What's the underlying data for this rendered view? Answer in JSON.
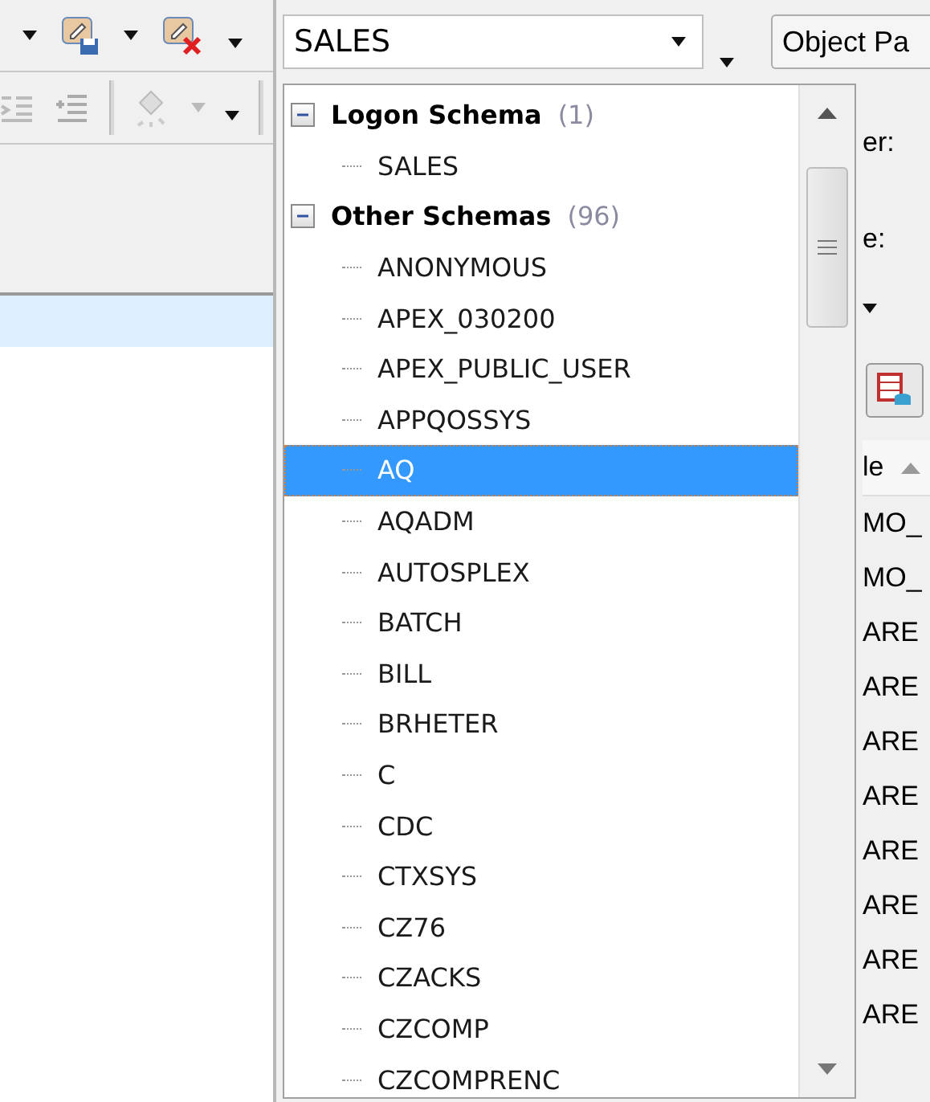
{
  "schema_combo": {
    "value": "SALES"
  },
  "object_panel_button": {
    "label": "Object Pa"
  },
  "right_panel": {
    "labels": [
      "er:",
      "e:"
    ],
    "table": {
      "column": "le",
      "rows": [
        "MO_",
        "MO_",
        "ARE",
        "ARE",
        "ARE",
        "ARE",
        "ARE",
        "ARE",
        "ARE",
        "ARE"
      ]
    }
  },
  "schema_dropdown": {
    "groups": [
      {
        "label": "Logon Schema",
        "count": "(1)",
        "expanded": true,
        "children": [
          {
            "label": "SALES",
            "selected": false
          }
        ]
      },
      {
        "label": "Other Schemas",
        "count": "(96)",
        "expanded": true,
        "children": [
          {
            "label": "ANONYMOUS",
            "selected": false
          },
          {
            "label": "APEX_030200",
            "selected": false
          },
          {
            "label": "APEX_PUBLIC_USER",
            "selected": false
          },
          {
            "label": "APPQOSSYS",
            "selected": false
          },
          {
            "label": "AQ",
            "selected": true
          },
          {
            "label": "AQADM",
            "selected": false
          },
          {
            "label": "AUTOSPLEX",
            "selected": false
          },
          {
            "label": "BATCH",
            "selected": false
          },
          {
            "label": "BILL",
            "selected": false
          },
          {
            "label": "BRHETER",
            "selected": false
          },
          {
            "label": "C",
            "selected": false
          },
          {
            "label": "CDC",
            "selected": false
          },
          {
            "label": "CTXSYS",
            "selected": false
          },
          {
            "label": "CZ76",
            "selected": false
          },
          {
            "label": "CZACKS",
            "selected": false
          },
          {
            "label": "CZCOMP",
            "selected": false
          },
          {
            "label": "CZCOMPRENC",
            "selected": false
          }
        ]
      }
    ]
  }
}
